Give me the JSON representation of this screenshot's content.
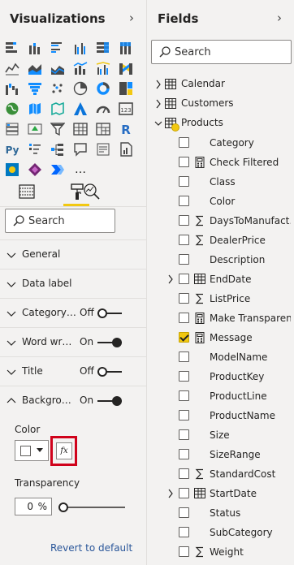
{
  "visualizations": {
    "title": "Visualizations",
    "more_glyph": "…",
    "search_placeholder": "Search",
    "sections": [
      {
        "label": "General",
        "toggle": null,
        "expanded": false
      },
      {
        "label": "Data label",
        "toggle": null,
        "expanded": false
      },
      {
        "label": "Category…",
        "toggle": "Off",
        "expanded": false
      },
      {
        "label": "Word wr…",
        "toggle": "On",
        "expanded": false
      },
      {
        "label": "Title",
        "toggle": "Off",
        "expanded": false
      },
      {
        "label": "Backgro…",
        "toggle": "On",
        "expanded": true
      }
    ],
    "color_label": "Color",
    "fx_label": "fx",
    "transparency_label": "Transparency",
    "transparency_value": "0",
    "transparency_unit": "%",
    "transparency_fraction": 0,
    "revert_label": "Revert to default",
    "accent_color": "#f2c811",
    "highlight_color": "#d0021b"
  },
  "fields": {
    "title": "Fields",
    "search_placeholder": "Search",
    "tables": [
      {
        "name": "Calendar",
        "expanded": false
      },
      {
        "name": "Customers",
        "expanded": false
      },
      {
        "name": "Products",
        "expanded": true
      }
    ],
    "items": [
      {
        "name": "Category",
        "checked": false,
        "icon": "none",
        "expandable": false
      },
      {
        "name": "Check Filtered",
        "checked": false,
        "icon": "calculator-icon",
        "expandable": false
      },
      {
        "name": "Class",
        "checked": false,
        "icon": "none",
        "expandable": false
      },
      {
        "name": "Color",
        "checked": false,
        "icon": "none",
        "expandable": false
      },
      {
        "name": "DaysToManufact…",
        "checked": false,
        "icon": "sigma-icon",
        "expandable": false
      },
      {
        "name": "DealerPrice",
        "checked": false,
        "icon": "sigma-icon",
        "expandable": false
      },
      {
        "name": "Description",
        "checked": false,
        "icon": "none",
        "expandable": false
      },
      {
        "name": "EndDate",
        "checked": false,
        "icon": "calendar-table-icon",
        "expandable": true
      },
      {
        "name": "ListPrice",
        "checked": false,
        "icon": "sigma-icon",
        "expandable": false
      },
      {
        "name": "Make Transparent",
        "checked": false,
        "icon": "calculator-icon",
        "expandable": false
      },
      {
        "name": "Message",
        "checked": true,
        "icon": "calculator-icon",
        "expandable": false
      },
      {
        "name": "ModelName",
        "checked": false,
        "icon": "none",
        "expandable": false
      },
      {
        "name": "ProductKey",
        "checked": false,
        "icon": "none",
        "expandable": false
      },
      {
        "name": "ProductLine",
        "checked": false,
        "icon": "none",
        "expandable": false
      },
      {
        "name": "ProductName",
        "checked": false,
        "icon": "none",
        "expandable": false
      },
      {
        "name": "Size",
        "checked": false,
        "icon": "none",
        "expandable": false
      },
      {
        "name": "SizeRange",
        "checked": false,
        "icon": "none",
        "expandable": false
      },
      {
        "name": "StandardCost",
        "checked": false,
        "icon": "sigma-icon",
        "expandable": false
      },
      {
        "name": "StartDate",
        "checked": false,
        "icon": "calendar-table-icon",
        "expandable": true
      },
      {
        "name": "Status",
        "checked": false,
        "icon": "none",
        "expandable": false
      },
      {
        "name": "SubCategory",
        "checked": false,
        "icon": "none",
        "expandable": false
      },
      {
        "name": "Weight",
        "checked": false,
        "icon": "sigma-icon",
        "expandable": false
      }
    ]
  }
}
